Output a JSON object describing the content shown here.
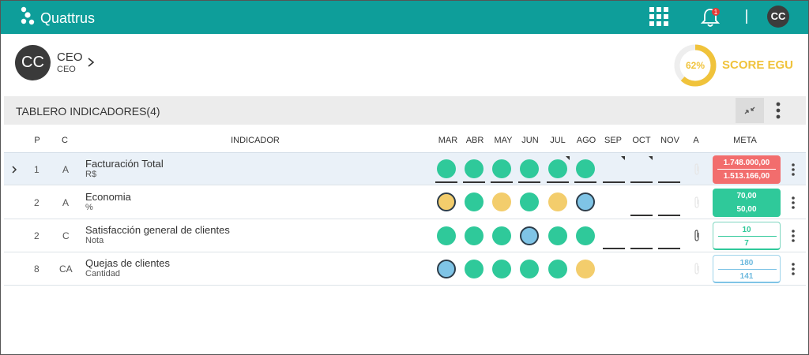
{
  "app": {
    "brand": "Quattrus",
    "notification_count": "1",
    "user_initials": "CC"
  },
  "profile": {
    "initials": "CC",
    "role": "CEO",
    "role_sub": "CEO"
  },
  "score": {
    "percent_label": "62%",
    "percent": 62,
    "label": "SCORE EGU",
    "color": "#f0c33b"
  },
  "panel": {
    "title": "TABLERO INDICADORES(4)"
  },
  "columns": {
    "p": "P",
    "c": "C",
    "indicador": "INDICADOR",
    "months": [
      "MAR",
      "ABR",
      "MAY",
      "JUN",
      "JUL",
      "AGO",
      "SEP",
      "OCT",
      "NOV"
    ],
    "a": "A",
    "meta": "META"
  },
  "rows": [
    {
      "p": "1",
      "c": "A",
      "name": "Facturación Total",
      "unit": "R$",
      "meta_top": "1.748.000,00",
      "meta_bottom": "1.513.166,00"
    },
    {
      "p": "2",
      "c": "A",
      "name": "Economia",
      "unit": "%",
      "meta_top": "70,00",
      "meta_bottom": "50,00"
    },
    {
      "p": "2",
      "c": "C",
      "name": "Satisfacción general de clientes",
      "unit": "Nota",
      "meta_top": "10",
      "meta_bottom": "7"
    },
    {
      "p": "8",
      "c": "CA",
      "name": "Quejas de clientes",
      "unit": "Cantidad",
      "meta_top": "180",
      "meta_bottom": "141"
    }
  ],
  "status_colors": {
    "green": "#2fc99a",
    "yellow": "#f3cd6c",
    "blue": "#7fc4e6",
    "red": "#f26d6d"
  }
}
